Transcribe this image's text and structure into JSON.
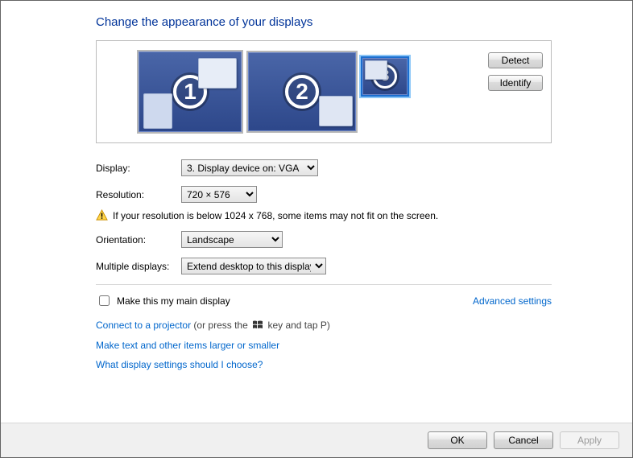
{
  "title": "Change the appearance of your displays",
  "side_buttons": {
    "detect": "Detect",
    "identify": "Identify"
  },
  "monitors": [
    {
      "num": "1",
      "selected": false
    },
    {
      "num": "2",
      "selected": false
    },
    {
      "num": "3",
      "selected": true
    }
  ],
  "labels": {
    "display": "Display:",
    "resolution": "Resolution:",
    "orientation": "Orientation:",
    "multiple": "Multiple displays:"
  },
  "values": {
    "display": "3. Display device on: VGA",
    "resolution": "720 × 576",
    "orientation": "Landscape",
    "multiple": "Extend desktop to this display"
  },
  "warning": "If your resolution is below 1024 x 768, some items may not fit on the screen.",
  "checkbox_label": "Make this my main display",
  "advanced_link": "Advanced settings",
  "links": {
    "projector_prefix": "Connect to a projector",
    "projector_suffix_a": " (or press the ",
    "projector_suffix_b": " key and tap P)",
    "larger": "Make text and other items larger or smaller",
    "which": "What display settings should I choose?"
  },
  "footer": {
    "ok": "OK",
    "cancel": "Cancel",
    "apply": "Apply"
  }
}
